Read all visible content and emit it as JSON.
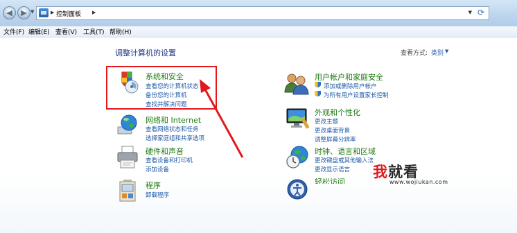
{
  "address": {
    "breadcrumb": "控制面板"
  },
  "menu": [
    "文件(F)",
    "编辑(E)",
    "查看(V)",
    "工具(T)",
    "帮助(H)"
  ],
  "main": {
    "heading": "调整计算机的设置",
    "view_by_label": "查看方式:",
    "view_by_value": "类别"
  },
  "categories": [
    {
      "title": "系统和安全",
      "links": [
        "查看您的计算机状态",
        "备份您的计算机",
        "查找并解决问题"
      ],
      "icon": "system-security-icon"
    },
    {
      "title": "网络和 Internet",
      "links": [
        "查看网络状态和任务",
        "选择家庭组和共享选项"
      ],
      "icon": "network-globe-icon"
    },
    {
      "title": "硬件和声音",
      "links": [
        "查看设备和打印机",
        "添加设备"
      ],
      "icon": "printer-icon"
    },
    {
      "title": "程序",
      "links": [
        "卸载程序"
      ],
      "icon": "programs-icon"
    },
    {
      "title": "用户帐户和家庭安全",
      "links": [
        "添加或删除用户帐户",
        "为所有用户设置家长控制"
      ],
      "icon": "users-icon"
    },
    {
      "title": "外观和个性化",
      "links": [
        "更改主题",
        "更改桌面背景",
        "调整屏幕分辨率"
      ],
      "icon": "monitor-icon"
    },
    {
      "title": "时钟、语言和区域",
      "links": [
        "更改键盘或其他输入法",
        "更改显示语言"
      ],
      "icon": "clock-globe-icon"
    },
    {
      "title": "轻松访问",
      "links": [],
      "icon": "ease-of-access-icon"
    }
  ],
  "watermark": {
    "brand_red": "我",
    "brand_rest": "就看",
    "url": "www.wojiukan.com"
  },
  "colors": {
    "category_title": "#1e7a12",
    "link": "#1e5aa8",
    "highlight": "#e2191b"
  }
}
